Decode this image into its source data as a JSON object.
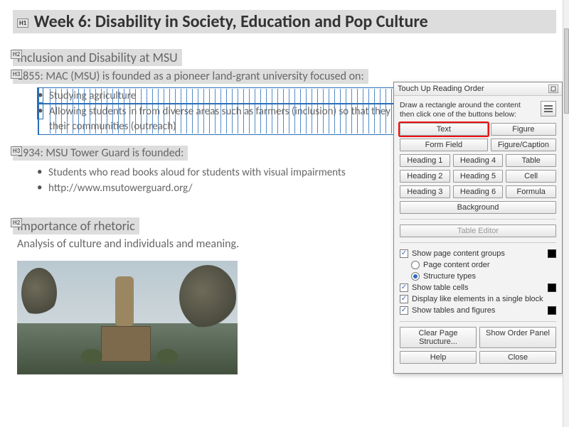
{
  "tags": {
    "h1": "H1",
    "h2": "H2",
    "h3": "H3"
  },
  "doc": {
    "title": "Week 6: Disability in Society, Education and Pop Culture",
    "h2_a": "Inclusion and Disability at MSU",
    "h3_a": "1855: MAC (MSU) is founded as a pioneer land-grant university focused on:",
    "list_a": [
      "Studying agriculture",
      "Allowing students in from diverse areas such as farmers (inclusion) so that they could become pillars of expertise for their communities (outreach)"
    ],
    "h3_b": "1934: MSU Tower Guard is founded:",
    "list_b": [
      "Students who read books aloud for students with visual impairments",
      "http://www.msutowerguard.org/"
    ],
    "h2_b": "Importance of rhetoric",
    "body": "Analysis of culture and individuals and meaning."
  },
  "dialog": {
    "title": "Touch Up Reading Order",
    "instructions": "Draw a rectangle around the content then click one of the buttons below:",
    "buttons": {
      "text": "Text",
      "figure": "Figure",
      "form_field": "Form Field",
      "figure_caption": "Figure/Caption",
      "h1": "Heading 1",
      "h4": "Heading 4",
      "table": "Table",
      "h2": "Heading 2",
      "h5": "Heading 5",
      "cell": "Cell",
      "h3": "Heading 3",
      "h6": "Heading 6",
      "formula": "Formula",
      "background": "Background",
      "table_editor": "Table Editor",
      "clear": "Clear Page Structure...",
      "show_order": "Show Order Panel",
      "help": "Help",
      "close": "Close"
    },
    "options": {
      "show_groups": "Show page content groups",
      "page_order": "Page content order",
      "structure_types": "Structure types",
      "show_cells": "Show table cells",
      "display_block": "Display like elements in a single block",
      "show_tables_figures": "Show tables and figures"
    },
    "state": {
      "show_groups": true,
      "page_order": false,
      "structure_types": true,
      "show_cells": true,
      "display_block": true,
      "show_tables_figures": true
    }
  }
}
